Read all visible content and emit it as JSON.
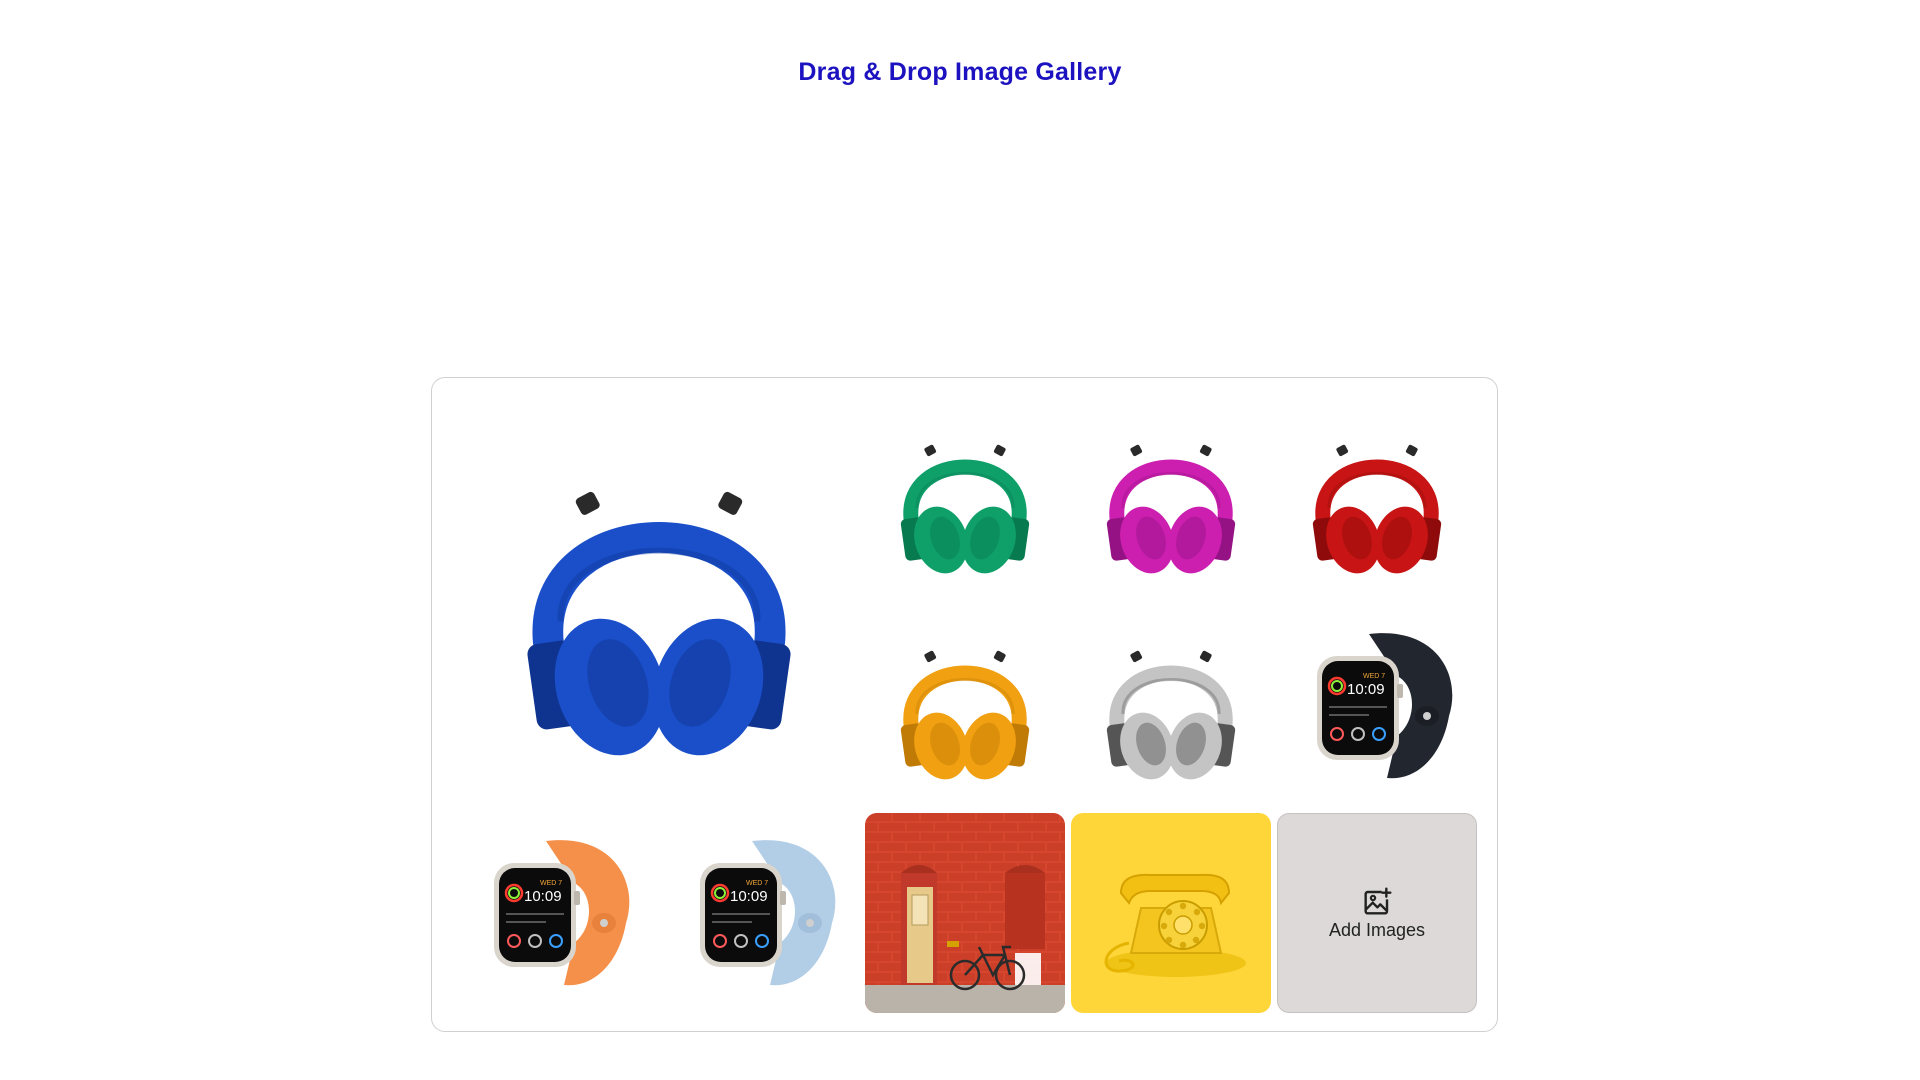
{
  "header": {
    "title": "Drag & Drop Image Gallery"
  },
  "gallery": {
    "items": [
      {
        "name": "headphones-blue",
        "kind": "headphones",
        "color": "#1a4fc9",
        "dark": "#0f3490"
      },
      {
        "name": "headphones-green",
        "kind": "headphones",
        "color": "#0fa06a",
        "dark": "#087a4f"
      },
      {
        "name": "headphones-magenta",
        "kind": "headphones",
        "color": "#cc1fb0",
        "dark": "#951284"
      },
      {
        "name": "headphones-red",
        "kind": "headphones",
        "color": "#c81414",
        "dark": "#8f0b0b"
      },
      {
        "name": "headphones-orange",
        "kind": "headphones",
        "color": "#f0a010",
        "dark": "#c07a06"
      },
      {
        "name": "headphones-silver",
        "kind": "headphones",
        "color": "#c4c4c4",
        "dark": "#555555"
      },
      {
        "name": "watch-midnight",
        "kind": "watch",
        "color": "#22262e",
        "dark": "#14171c",
        "time": "10:09",
        "date": "WED 7"
      },
      {
        "name": "watch-orange",
        "kind": "watch",
        "color": "#f5904a",
        "dark": "#d9712c",
        "time": "10:09",
        "date": "WED 7"
      },
      {
        "name": "watch-light-blue",
        "kind": "watch",
        "color": "#b2cde6",
        "dark": "#8fb0cf",
        "time": "10:09",
        "date": "WED 7"
      },
      {
        "name": "red-brick-wall-bicycle",
        "kind": "photo-wall"
      },
      {
        "name": "yellow-rotary-telephone",
        "kind": "photo-phone"
      }
    ],
    "add_label": "Add Images",
    "add_icon": "image-plus-icon"
  }
}
